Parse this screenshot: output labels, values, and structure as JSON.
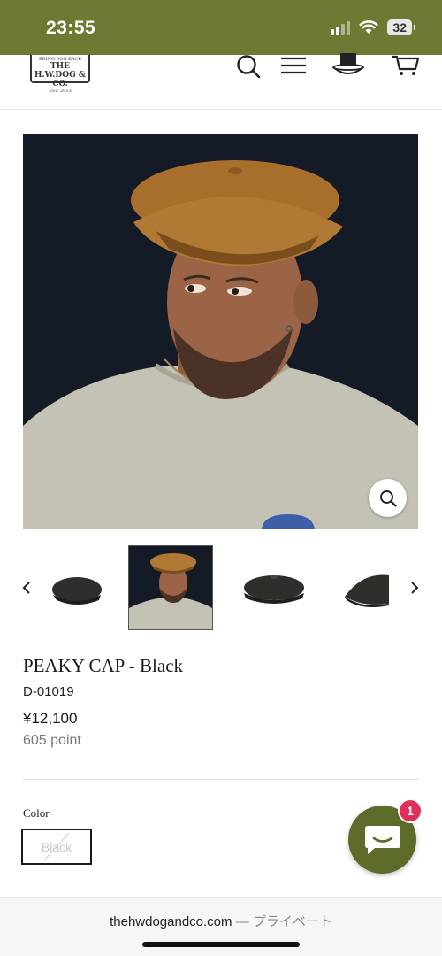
{
  "status_bar": {
    "time": "23:55",
    "battery": "32",
    "icons": [
      "signal-icon",
      "wifi-icon",
      "battery-icon"
    ]
  },
  "header": {
    "logo": {
      "line1": "BRING DOG BACK",
      "line2": "THE H.W.DOG & CO.",
      "line3": "EST. 2013"
    },
    "icons": [
      "search-icon",
      "menu-icon",
      "hat-icon",
      "cart-icon"
    ]
  },
  "product": {
    "title": "PEAKY CAP - Black",
    "sku": "D-01019",
    "price": "¥12,100",
    "points": "605 point",
    "color_label": "Color",
    "color_option": "Black"
  },
  "thumbnails": {
    "count": 4,
    "active_index": 1
  },
  "chat": {
    "badge": "1"
  },
  "browser": {
    "domain": "thehwdogandco.com",
    "separator": "—",
    "mode": "プライベート"
  },
  "colors": {
    "status_bar": "#6c7a33",
    "chat_button": "#5d6b2a",
    "badge": "#e0305a",
    "image_bg": "#141a26"
  }
}
